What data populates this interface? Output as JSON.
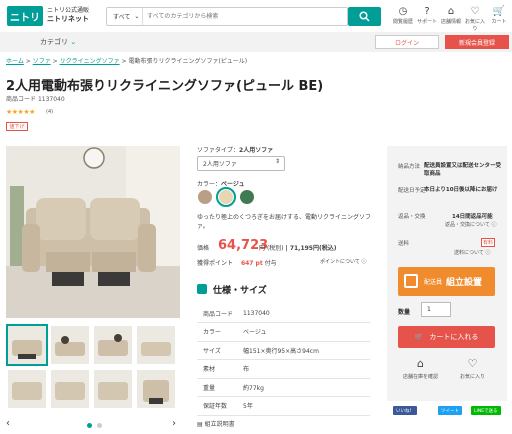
{
  "header": {
    "logo": "ニトリ",
    "logo_sub": "ニトリ公式通販",
    "logo_name": "ニトリネット",
    "search_scope": "すべて",
    "search_placeholder": "すべてのカテゴリから検索",
    "icons": [
      {
        "label": "閲覧履歴",
        "icon": "clock-icon"
      },
      {
        "label": "サポート",
        "icon": "question-icon"
      },
      {
        "label": "店舗情報",
        "icon": "store-icon"
      },
      {
        "label": "お気に入り",
        "icon": "heart-icon"
      },
      {
        "label": "カート",
        "icon": "cart-icon",
        "count": "0"
      }
    ]
  },
  "nav": {
    "category": "カテゴリ",
    "login": "ログイン",
    "register": "新規会員登録"
  },
  "breadcrumb": [
    "ホーム",
    "ソファ",
    "リクライニングソファ",
    "電動布張りリクライニングソファ(ピュール)"
  ],
  "product": {
    "title": "2人用電動布張りリクライニングソファ(ピュール BE)",
    "code_label": "商品コード",
    "code": "1137040",
    "stars": "★★★★★",
    "review_count": "(4)",
    "badge": "値下げ",
    "sofa_type_label": "ソファタイプ：",
    "sofa_type_value": "2人用ソファ",
    "select_value": "2人用ソファ",
    "color_label": "カラー：",
    "color_value": "ベージュ",
    "swatches": [
      "#b89f86",
      "#e6d6b1",
      "#3f7a52"
    ],
    "description": "ゆったり極上のくつろぎをお届けする、電動リクライニングソファ。",
    "price_label": "価格",
    "price": "64,723",
    "price_yen": "円",
    "price_tax_ex": "(税別)",
    "price_tax_in": "| 71,195円(税込)",
    "points_label": "獲得ポイント",
    "points": "647 pt",
    "points_suffix": "付与",
    "points_link": "ポイントについて"
  },
  "spec": {
    "title": "仕様・サイズ",
    "rows": [
      {
        "k": "商品コード",
        "v": "1137040"
      },
      {
        "k": "カラー",
        "v": "ベージュ"
      },
      {
        "k": "サイズ",
        "v": "幅151×奥行95×高さ94cm"
      },
      {
        "k": "素材",
        "v": "布"
      },
      {
        "k": "重量",
        "v": "約77kg"
      },
      {
        "k": "保証年数",
        "v": "5年"
      }
    ],
    "guide": "組立説明書"
  },
  "delivery": {
    "method_label": "納品方法",
    "method_value": "配送員設置又は配送センター受取商品",
    "date_label": "配送日予定",
    "date_value": "本日より10日後以降にお届け",
    "return_label": "返品・交換",
    "return_value": "14日間返品可能",
    "return_link": "返品・交換について",
    "shipping_label": "送料",
    "shipping_value": "有料",
    "shipping_link": "送料について",
    "service_label": "配送員",
    "service_value": "組立設置",
    "qty_label": "数量",
    "qty_value": "1",
    "cart_button": "カートに入れる",
    "store_stock": "店舗在庫を確認",
    "favorite": "お気に入り"
  },
  "share": [
    "いいね！",
    "ツイート",
    "LINEで送る"
  ]
}
